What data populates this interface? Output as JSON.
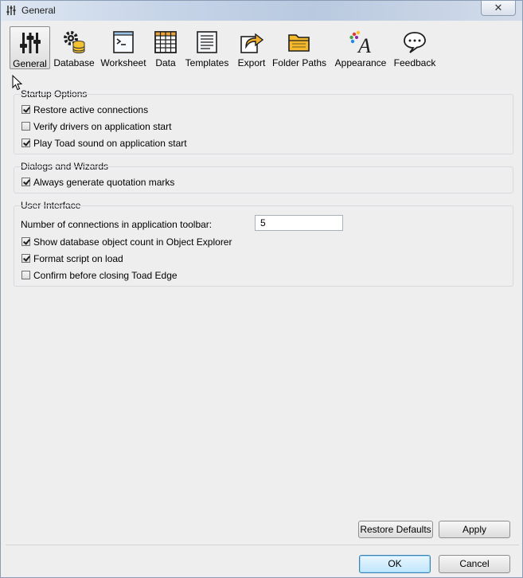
{
  "window": {
    "title": "General",
    "close_glyph": "✕"
  },
  "toolbar": {
    "items": [
      {
        "label": "General",
        "icon": "sliders-icon",
        "selected": true
      },
      {
        "label": "Database",
        "icon": "database-gear-icon"
      },
      {
        "label": "Worksheet",
        "icon": "terminal-icon"
      },
      {
        "label": "Data",
        "icon": "grid-icon"
      },
      {
        "label": "Templates",
        "icon": "document-list-icon"
      },
      {
        "label": "Export",
        "icon": "export-arrow-icon"
      },
      {
        "label": "Folder Paths",
        "icon": "folder-icon"
      },
      {
        "label": "Appearance",
        "icon": "font-appearance-icon"
      },
      {
        "label": "Feedback",
        "icon": "speech-bubble-icon"
      }
    ]
  },
  "startup": {
    "title": "Startup Options",
    "options": [
      {
        "label": "Restore active connections",
        "checked": true
      },
      {
        "label": "Verify drivers on application start",
        "checked": false
      },
      {
        "label": "Play Toad sound on application start",
        "checked": true
      }
    ]
  },
  "dialogs": {
    "title": "Dialogs and Wizards",
    "options": [
      {
        "label": "Always generate quotation marks",
        "checked": true
      }
    ]
  },
  "ui": {
    "title": "User Interface",
    "connections_label": "Number of connections in application toolbar:",
    "connections_value": "5",
    "options": [
      {
        "label": "Show database object count in Object Explorer",
        "checked": true
      },
      {
        "label": "Format script on load",
        "checked": true
      },
      {
        "label": "Confirm before closing Toad Edge",
        "checked": false
      }
    ]
  },
  "buttons": {
    "restore_defaults": "Restore Defaults",
    "apply": "Apply",
    "ok": "OK",
    "cancel": "Cancel"
  },
  "colors": {
    "accent": "#3c7fb1",
    "background": "#eeeeef"
  }
}
